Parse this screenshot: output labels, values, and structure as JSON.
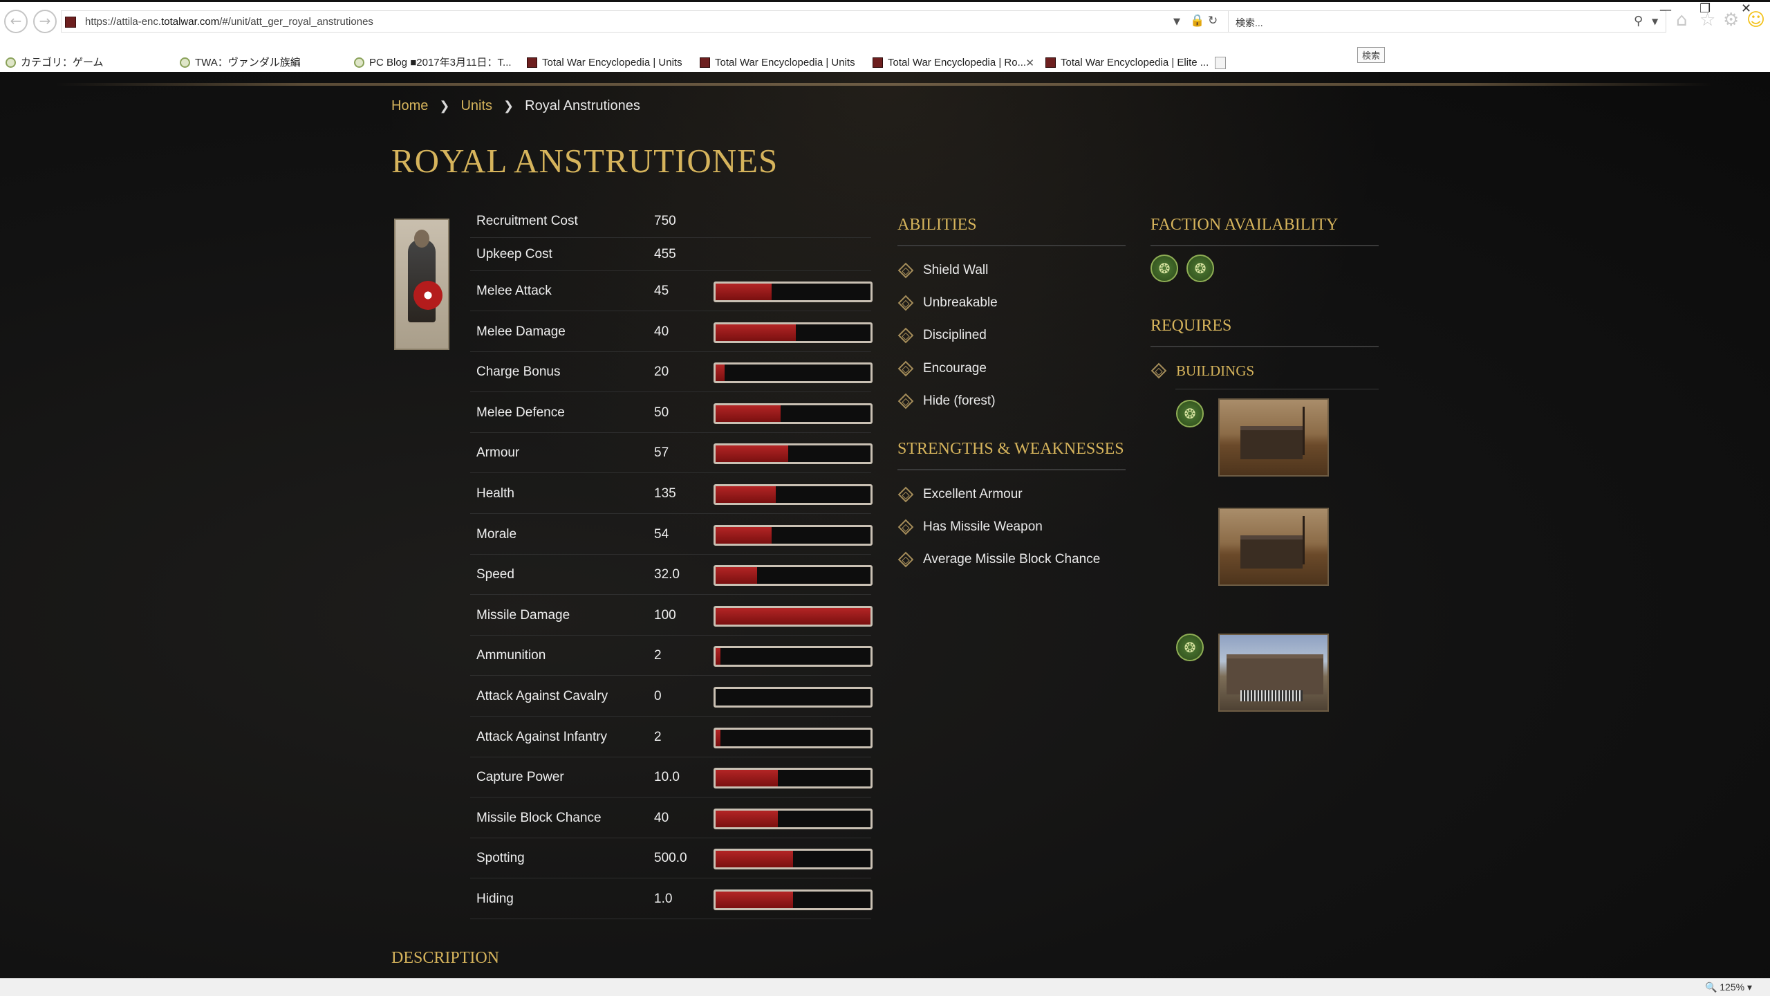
{
  "browser": {
    "url_prefix": "https://attila-enc.",
    "url_domain": "totalwar.com",
    "url_rest": "/#/unit/att_ger_royal_anstrutiones",
    "search_placeholder": "検索...",
    "tooltip": "検索",
    "tabs": [
      {
        "label": "カテゴリ：ゲーム",
        "kind": "bl"
      },
      {
        "label": "TWA：ヴァンダル族編",
        "kind": "bl"
      },
      {
        "label": "PC Blog ■2017年3月11日：T...",
        "kind": "bl"
      },
      {
        "label": "Total War Encyclopedia | Units",
        "kind": "tw"
      },
      {
        "label": "Total War Encyclopedia | Units",
        "kind": "tw"
      },
      {
        "label": "Total War Encyclopedia | Ro...",
        "kind": "tw",
        "active": true
      },
      {
        "label": "Total War Encyclopedia | Elite ...",
        "kind": "tw"
      }
    ],
    "zoom": "125%"
  },
  "breadcrumb": {
    "home": "Home",
    "units": "Units",
    "current": "Royal Anstrutiones"
  },
  "unit": {
    "title": "ROYAL ANSTRUTIONES",
    "costs": [
      {
        "label": "Recruitment Cost",
        "value": "750"
      },
      {
        "label": "Upkeep Cost",
        "value": "455"
      }
    ],
    "stats": [
      {
        "label": "Melee Attack",
        "value": "45",
        "fill_pct": 36
      },
      {
        "label": "Melee Damage",
        "value": "40",
        "fill_pct": 52
      },
      {
        "label": "Charge Bonus",
        "value": "20",
        "fill_pct": 6
      },
      {
        "label": "Melee Defence",
        "value": "50",
        "fill_pct": 42
      },
      {
        "label": "Armour",
        "value": "57",
        "fill_pct": 47
      },
      {
        "label": "Health",
        "value": "135",
        "fill_pct": 39
      },
      {
        "label": "Morale",
        "value": "54",
        "fill_pct": 36
      },
      {
        "label": "Speed",
        "value": "32.0",
        "fill_pct": 27
      },
      {
        "label": "Missile Damage",
        "value": "100",
        "fill_pct": 100
      },
      {
        "label": "Ammunition",
        "value": "2",
        "fill_pct": 3
      },
      {
        "label": "Attack Against Cavalry",
        "value": "0",
        "fill_pct": 0
      },
      {
        "label": "Attack Against Infantry",
        "value": "2",
        "fill_pct": 3
      },
      {
        "label": "Capture Power",
        "value": "10.0",
        "fill_pct": 40
      },
      {
        "label": "Missile Block Chance",
        "value": "40",
        "fill_pct": 40
      },
      {
        "label": "Spotting",
        "value": "500.0",
        "fill_pct": 50
      },
      {
        "label": "Hiding",
        "value": "1.0",
        "fill_pct": 50
      }
    ]
  },
  "abilities": {
    "heading": "ABILITIES",
    "items": [
      "Shield Wall",
      "Unbreakable",
      "Disciplined",
      "Encourage",
      "Hide (forest)"
    ]
  },
  "strengths": {
    "heading": "STRENGTHS & WEAKNESSES",
    "items": [
      "Excellent Armour",
      "Has Missile Weapon",
      "Average Missile Block Chance"
    ]
  },
  "faction": {
    "heading": "FACTION AVAILABILITY",
    "emblem_icon": "triskele-icon",
    "count": 2
  },
  "requires": {
    "heading": "REQUIRES",
    "buildings_label": "BUILDINGS"
  },
  "description": {
    "heading": "DESCRIPTION"
  }
}
